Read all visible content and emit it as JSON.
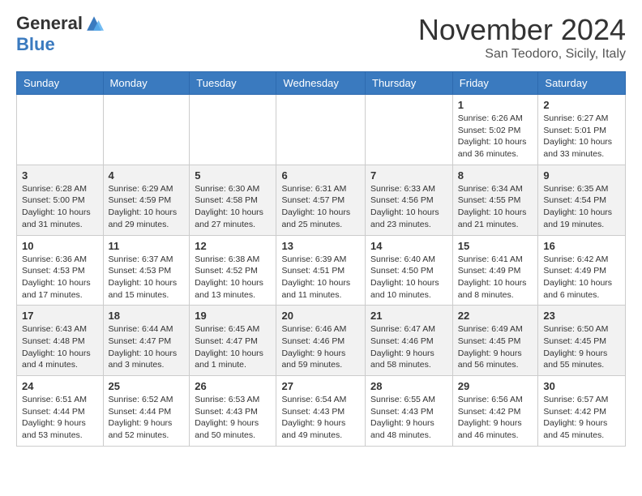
{
  "logo": {
    "general": "General",
    "blue": "Blue"
  },
  "header": {
    "month_title": "November 2024",
    "location": "San Teodoro, Sicily, Italy"
  },
  "days_of_week": [
    "Sunday",
    "Monday",
    "Tuesday",
    "Wednesday",
    "Thursday",
    "Friday",
    "Saturday"
  ],
  "weeks": [
    [
      {
        "day": "",
        "info": ""
      },
      {
        "day": "",
        "info": ""
      },
      {
        "day": "",
        "info": ""
      },
      {
        "day": "",
        "info": ""
      },
      {
        "day": "",
        "info": ""
      },
      {
        "day": "1",
        "info": "Sunrise: 6:26 AM\nSunset: 5:02 PM\nDaylight: 10 hours and 36 minutes."
      },
      {
        "day": "2",
        "info": "Sunrise: 6:27 AM\nSunset: 5:01 PM\nDaylight: 10 hours and 33 minutes."
      }
    ],
    [
      {
        "day": "3",
        "info": "Sunrise: 6:28 AM\nSunset: 5:00 PM\nDaylight: 10 hours and 31 minutes."
      },
      {
        "day": "4",
        "info": "Sunrise: 6:29 AM\nSunset: 4:59 PM\nDaylight: 10 hours and 29 minutes."
      },
      {
        "day": "5",
        "info": "Sunrise: 6:30 AM\nSunset: 4:58 PM\nDaylight: 10 hours and 27 minutes."
      },
      {
        "day": "6",
        "info": "Sunrise: 6:31 AM\nSunset: 4:57 PM\nDaylight: 10 hours and 25 minutes."
      },
      {
        "day": "7",
        "info": "Sunrise: 6:33 AM\nSunset: 4:56 PM\nDaylight: 10 hours and 23 minutes."
      },
      {
        "day": "8",
        "info": "Sunrise: 6:34 AM\nSunset: 4:55 PM\nDaylight: 10 hours and 21 minutes."
      },
      {
        "day": "9",
        "info": "Sunrise: 6:35 AM\nSunset: 4:54 PM\nDaylight: 10 hours and 19 minutes."
      }
    ],
    [
      {
        "day": "10",
        "info": "Sunrise: 6:36 AM\nSunset: 4:53 PM\nDaylight: 10 hours and 17 minutes."
      },
      {
        "day": "11",
        "info": "Sunrise: 6:37 AM\nSunset: 4:53 PM\nDaylight: 10 hours and 15 minutes."
      },
      {
        "day": "12",
        "info": "Sunrise: 6:38 AM\nSunset: 4:52 PM\nDaylight: 10 hours and 13 minutes."
      },
      {
        "day": "13",
        "info": "Sunrise: 6:39 AM\nSunset: 4:51 PM\nDaylight: 10 hours and 11 minutes."
      },
      {
        "day": "14",
        "info": "Sunrise: 6:40 AM\nSunset: 4:50 PM\nDaylight: 10 hours and 10 minutes."
      },
      {
        "day": "15",
        "info": "Sunrise: 6:41 AM\nSunset: 4:49 PM\nDaylight: 10 hours and 8 minutes."
      },
      {
        "day": "16",
        "info": "Sunrise: 6:42 AM\nSunset: 4:49 PM\nDaylight: 10 hours and 6 minutes."
      }
    ],
    [
      {
        "day": "17",
        "info": "Sunrise: 6:43 AM\nSunset: 4:48 PM\nDaylight: 10 hours and 4 minutes."
      },
      {
        "day": "18",
        "info": "Sunrise: 6:44 AM\nSunset: 4:47 PM\nDaylight: 10 hours and 3 minutes."
      },
      {
        "day": "19",
        "info": "Sunrise: 6:45 AM\nSunset: 4:47 PM\nDaylight: 10 hours and 1 minute."
      },
      {
        "day": "20",
        "info": "Sunrise: 6:46 AM\nSunset: 4:46 PM\nDaylight: 9 hours and 59 minutes."
      },
      {
        "day": "21",
        "info": "Sunrise: 6:47 AM\nSunset: 4:46 PM\nDaylight: 9 hours and 58 minutes."
      },
      {
        "day": "22",
        "info": "Sunrise: 6:49 AM\nSunset: 4:45 PM\nDaylight: 9 hours and 56 minutes."
      },
      {
        "day": "23",
        "info": "Sunrise: 6:50 AM\nSunset: 4:45 PM\nDaylight: 9 hours and 55 minutes."
      }
    ],
    [
      {
        "day": "24",
        "info": "Sunrise: 6:51 AM\nSunset: 4:44 PM\nDaylight: 9 hours and 53 minutes."
      },
      {
        "day": "25",
        "info": "Sunrise: 6:52 AM\nSunset: 4:44 PM\nDaylight: 9 hours and 52 minutes."
      },
      {
        "day": "26",
        "info": "Sunrise: 6:53 AM\nSunset: 4:43 PM\nDaylight: 9 hours and 50 minutes."
      },
      {
        "day": "27",
        "info": "Sunrise: 6:54 AM\nSunset: 4:43 PM\nDaylight: 9 hours and 49 minutes."
      },
      {
        "day": "28",
        "info": "Sunrise: 6:55 AM\nSunset: 4:43 PM\nDaylight: 9 hours and 48 minutes."
      },
      {
        "day": "29",
        "info": "Sunrise: 6:56 AM\nSunset: 4:42 PM\nDaylight: 9 hours and 46 minutes."
      },
      {
        "day": "30",
        "info": "Sunrise: 6:57 AM\nSunset: 4:42 PM\nDaylight: 9 hours and 45 minutes."
      }
    ]
  ]
}
